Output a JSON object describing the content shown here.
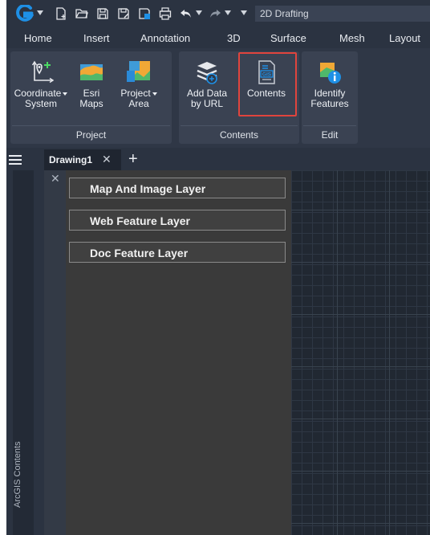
{
  "workspace": {
    "selected": "2D Drafting"
  },
  "menu_tabs": [
    "Home",
    "Insert",
    "Annotation",
    "3D",
    "Surface",
    "Mesh",
    "Layout"
  ],
  "ribbon": {
    "groups": [
      {
        "label": "Project",
        "buttons": [
          {
            "line1": "Coordinate",
            "line2": "System",
            "icon": "coordinate-system-icon"
          },
          {
            "line1": "Esri",
            "line2": "Maps",
            "icon": "esri-maps-icon"
          },
          {
            "line1": "Project",
            "line2": "Area",
            "icon": "project-area-icon"
          }
        ]
      },
      {
        "label": "Contents",
        "buttons": [
          {
            "line1": "Add Data",
            "line2": "by URL",
            "icon": "add-data-url-icon"
          },
          {
            "line1": "Contents",
            "line2": "",
            "icon": "gis-contents-icon"
          }
        ]
      },
      {
        "label": "Edit",
        "buttons": [
          {
            "line1": "Identify",
            "line2": "Features",
            "icon": "identify-features-icon"
          }
        ]
      }
    ]
  },
  "document": {
    "tab_label": "Drawing1"
  },
  "side_panel": {
    "vertical_title": "ArcGIS Contents",
    "layers": [
      "Map And Image Layer",
      "Web Feature Layer",
      "Doc Feature Layer"
    ]
  },
  "colors": {
    "highlight": "#e0443d",
    "brand": "#1e90e6",
    "panel": "#3a3a3a"
  }
}
